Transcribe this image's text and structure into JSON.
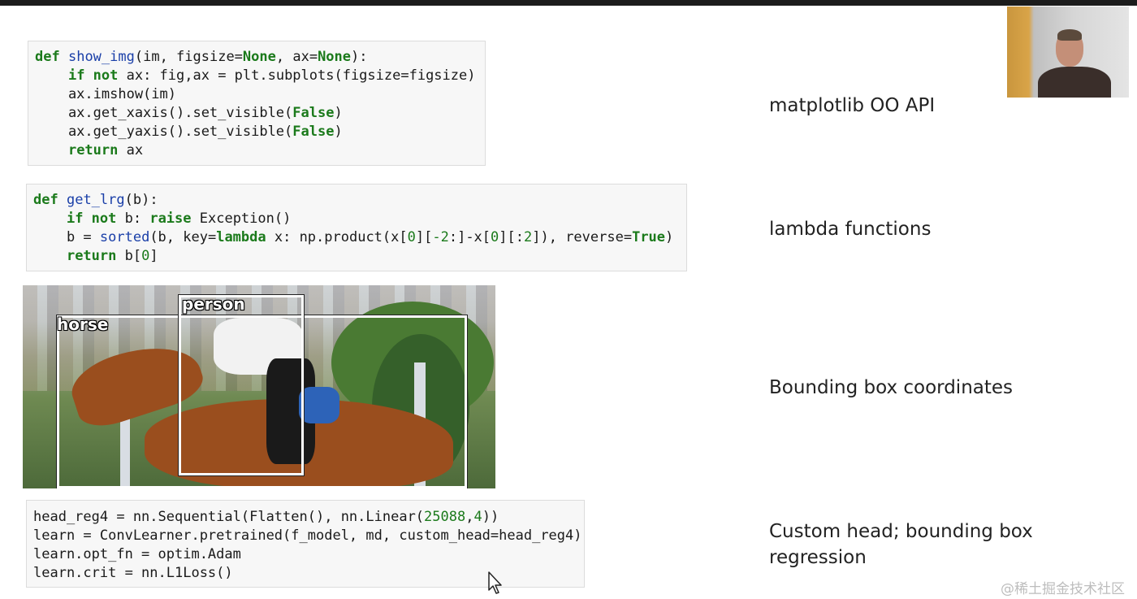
{
  "cells": {
    "show_img": {
      "lines": [
        [
          [
            "kw",
            "def"
          ],
          [
            "t",
            " "
          ],
          [
            "fn",
            "show_img"
          ],
          [
            "t",
            "(im, figsize="
          ],
          [
            "kw",
            "None"
          ],
          [
            "t",
            ", ax="
          ],
          [
            "kw",
            "None"
          ],
          [
            "t",
            "):"
          ]
        ],
        [
          [
            "t",
            "    "
          ],
          [
            "kw",
            "if not"
          ],
          [
            "t",
            " ax: fig,ax = plt.subplots(figsize=figsize)"
          ]
        ],
        [
          [
            "t",
            "    ax.imshow(im)"
          ]
        ],
        [
          [
            "t",
            "    ax.get_xaxis().set_visible("
          ],
          [
            "kw",
            "False"
          ],
          [
            "t",
            ")"
          ]
        ],
        [
          [
            "t",
            "    ax.get_yaxis().set_visible("
          ],
          [
            "kw",
            "False"
          ],
          [
            "t",
            ")"
          ]
        ],
        [
          [
            "t",
            "    "
          ],
          [
            "kw",
            "return"
          ],
          [
            "t",
            " ax"
          ]
        ]
      ]
    },
    "get_lrg": {
      "lines": [
        [
          [
            "kw",
            "def"
          ],
          [
            "t",
            " "
          ],
          [
            "fn",
            "get_lrg"
          ],
          [
            "t",
            "(b):"
          ]
        ],
        [
          [
            "t",
            "    "
          ],
          [
            "kw",
            "if not"
          ],
          [
            "t",
            " b: "
          ],
          [
            "kw",
            "raise"
          ],
          [
            "t",
            " Exception()"
          ]
        ],
        [
          [
            "t",
            "    b = "
          ],
          [
            "fn",
            "sorted"
          ],
          [
            "t",
            "(b, key="
          ],
          [
            "kw",
            "lambda"
          ],
          [
            "t",
            " x: np.product(x["
          ],
          [
            "num",
            "0"
          ],
          [
            "t",
            "]["
          ],
          [
            "num",
            "-2"
          ],
          [
            "t",
            ":]-x["
          ],
          [
            "num",
            "0"
          ],
          [
            "t",
            "][:"
          ],
          [
            "num",
            "2"
          ],
          [
            "t",
            "]), reverse="
          ],
          [
            "kw",
            "True"
          ],
          [
            "t",
            ")"
          ]
        ],
        [
          [
            "t",
            "    "
          ],
          [
            "kw",
            "return"
          ],
          [
            "t",
            " b["
          ],
          [
            "num",
            "0"
          ],
          [
            "t",
            "]"
          ]
        ]
      ]
    },
    "head_reg": {
      "lines": [
        [
          [
            "t",
            "head_reg4 = nn.Sequential(Flatten(), nn.Linear("
          ],
          [
            "num",
            "25088"
          ],
          [
            "t",
            ","
          ],
          [
            "num",
            "4"
          ],
          [
            "t",
            "))"
          ]
        ],
        [
          [
            "t",
            "learn = ConvLearner.pretrained(f_model, md, custom_head=head_reg4)"
          ]
        ],
        [
          [
            "t",
            "learn.opt_fn = optim.Adam"
          ]
        ],
        [
          [
            "t",
            "learn.crit = nn.L1Loss()"
          ]
        ]
      ]
    }
  },
  "labels": {
    "oo_api": "matplotlib OO API",
    "lambda": "lambda functions",
    "bbox": "Bounding box coordinates",
    "custom_head": "Custom head; bounding box regression"
  },
  "image": {
    "box_labels": {
      "horse": "horse",
      "person": "person"
    }
  },
  "watermark": "@稀土掘金技术社区",
  "colors": {
    "keyword": "#1b7a1b",
    "function": "#1a3fa8",
    "cell_bg": "#f7f7f7",
    "top_bar": "#1c1c1c"
  }
}
